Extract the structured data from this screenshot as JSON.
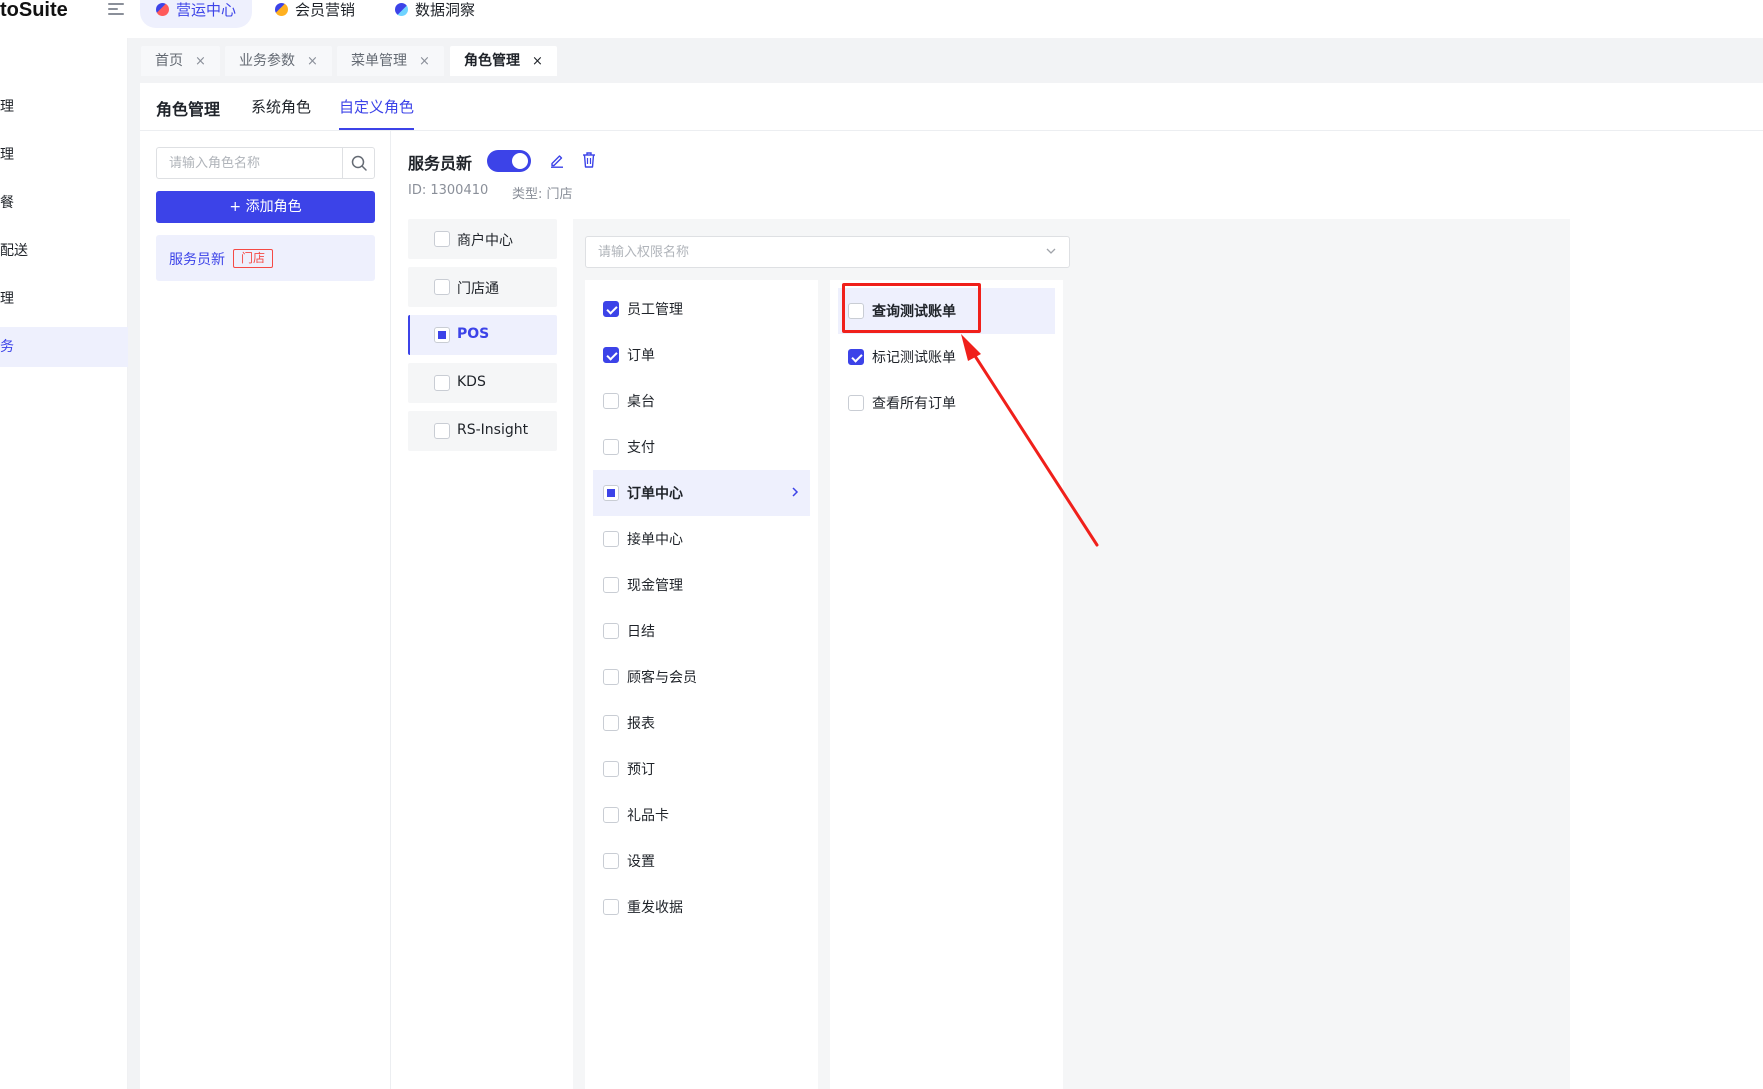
{
  "app": {
    "brand": "toSuite"
  },
  "top_nav": [
    {
      "label": "营运中心",
      "active": true
    },
    {
      "label": "会员营销",
      "active": false
    },
    {
      "label": "数据洞察",
      "active": false
    }
  ],
  "sidebar": {
    "items": [
      {
        "label": "管理"
      },
      {
        "label": "管理"
      },
      {
        "label": "套餐"
      },
      {
        "label": "和配送"
      },
      {
        "label": "管理"
      },
      {
        "label": "服务"
      }
    ]
  },
  "page_tabs": [
    {
      "label": "首页",
      "close": "×"
    },
    {
      "label": "业务参数",
      "close": "×"
    },
    {
      "label": "菜单管理",
      "close": "×"
    },
    {
      "label": "角色管理",
      "close": "×"
    }
  ],
  "subtabs": {
    "title": "角色管理",
    "system": "系统角色",
    "custom": "自定义角色"
  },
  "role_list": {
    "search_placeholder": "请输入角色名称",
    "add_button": "+ 添加角色",
    "items": [
      {
        "name": "服务员新",
        "tag": "门店"
      }
    ]
  },
  "role_detail": {
    "name": "服务员新",
    "enabled": true,
    "id_text": "ID: 1300410",
    "type_text": "类型: 门店"
  },
  "modules": [
    {
      "label": "商户中心"
    },
    {
      "label": "门店通"
    },
    {
      "label": "POS"
    },
    {
      "label": "KDS"
    },
    {
      "label": "RS-Insight"
    }
  ],
  "permissions": {
    "search_placeholder": "请输入权限名称",
    "items": [
      {
        "label": "员工管理",
        "state": "checked"
      },
      {
        "label": "订单",
        "state": "checked"
      },
      {
        "label": "桌台",
        "state": "unchecked"
      },
      {
        "label": "支付",
        "state": "unchecked"
      },
      {
        "label": "订单中心",
        "state": "partial"
      },
      {
        "label": "接单中心",
        "state": "unchecked"
      },
      {
        "label": "现金管理",
        "state": "unchecked"
      },
      {
        "label": "日结",
        "state": "unchecked"
      },
      {
        "label": "顾客与会员",
        "state": "unchecked"
      },
      {
        "label": "报表",
        "state": "unchecked"
      },
      {
        "label": "预订",
        "state": "unchecked"
      },
      {
        "label": "礼品卡",
        "state": "unchecked"
      },
      {
        "label": "设置",
        "state": "unchecked"
      },
      {
        "label": "重发收据",
        "state": "unchecked"
      }
    ],
    "sub_items": [
      {
        "label": "查询测试账单",
        "state": "unchecked"
      },
      {
        "label": "标记测试账单",
        "state": "checked"
      },
      {
        "label": "查看所有订单",
        "state": "unchecked"
      }
    ]
  },
  "colors": {
    "accent": "#3c43e8",
    "accent_light": "#eef0fd",
    "annotation_red": "#f0201b",
    "tag_red": "#f54a45"
  }
}
